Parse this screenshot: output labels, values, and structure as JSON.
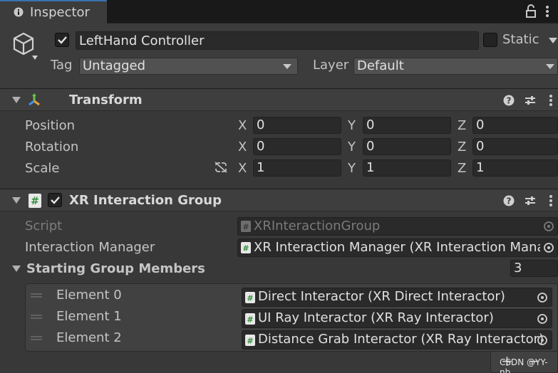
{
  "tab": {
    "label": "Inspector",
    "icon": "info-icon"
  },
  "header": {
    "name": "LeftHand Controller",
    "active": true,
    "static_label": "Static",
    "static_checked": false,
    "tag_label": "Tag",
    "tag_value": "Untagged",
    "layer_label": "Layer",
    "layer_value": "Default"
  },
  "transform": {
    "title": "Transform",
    "rows": [
      {
        "label": "Position",
        "x": "0",
        "y": "0",
        "z": "0"
      },
      {
        "label": "Rotation",
        "x": "0",
        "y": "0",
        "z": "0"
      },
      {
        "label": "Scale",
        "x": "1",
        "y": "1",
        "z": "1"
      }
    ],
    "axis": {
      "x": "X",
      "y": "Y",
      "z": "Z"
    }
  },
  "xr_group": {
    "title": "XR Interaction Group",
    "enabled": true,
    "script_label": "Script",
    "script_value": "XRInteractionGroup",
    "manager_label": "Interaction Manager",
    "manager_value": "XR Interaction Manager (XR Interaction Manag",
    "members_label": "Starting Group Members",
    "members_count": "3",
    "elements": [
      {
        "label": "Element 0",
        "value": "Direct Interactor (XR Direct Interactor)"
      },
      {
        "label": "Element 1",
        "value": "UI Ray Interactor (XR Ray Interactor)"
      },
      {
        "label": "Element 2",
        "value": "Distance Grab Interactor  (XR Ray Interactor)"
      }
    ]
  },
  "footer": {
    "add_label": "+",
    "remove_label": "−"
  },
  "watermark": "CSDN @YY-nb",
  "colors": {
    "accent": "#3a72b0",
    "panel": "#383838",
    "field": "#2a2a2a"
  }
}
